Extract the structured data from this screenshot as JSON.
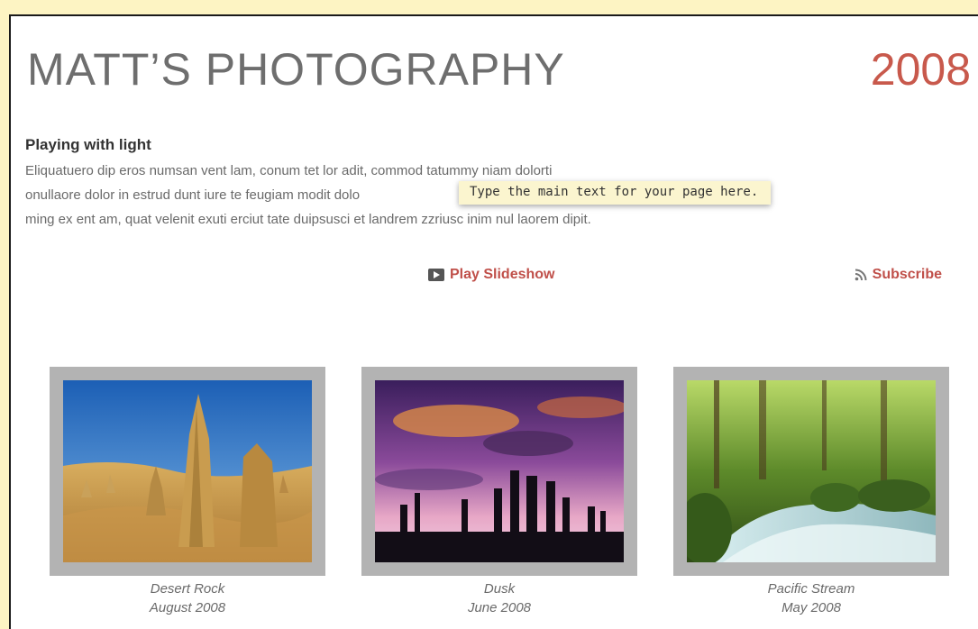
{
  "site": {
    "title": "MATT’S PHOTOGRAPHY",
    "year": "2008"
  },
  "content": {
    "heading": "Playing with light",
    "lines": [
      "Eliquatuero dip eros numsan vent lam, conum tet lor adit, commod tatummy niam dolorti",
      "onullaore dolor in estrud dunt iure te feugiam modit dolo",
      "ming ex ent am, quat velenit exuti erciut tate duipsusci et landrem zzriusc inim nul laorem dipit."
    ],
    "tooltip": "Type the main text for your page here."
  },
  "actions": {
    "slideshow_label": "Play Slideshow",
    "slideshow_icon": "play-icon",
    "subscribe_label": "Subscribe",
    "subscribe_icon": "rss-icon",
    "accent_color": "#c0504a"
  },
  "albums": [
    {
      "title": "Desert Rock",
      "date": "August 2008"
    },
    {
      "title": "Dusk",
      "date": "June 2008"
    },
    {
      "title": "Pacific Stream",
      "date": "May 2008"
    }
  ]
}
